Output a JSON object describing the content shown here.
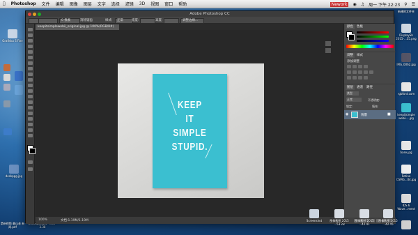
{
  "menubar": {
    "apple": "",
    "app": "Photoshop",
    "items": [
      "文件",
      "编辑",
      "图像",
      "图层",
      "文字",
      "选择",
      "滤镜",
      "3D",
      "视图",
      "窗口",
      "帮助"
    ],
    "right_app": "Nework",
    "clock": "周一 下午 22:23"
  },
  "window": {
    "title": "Adobe Photoshop CC",
    "doc_tab": "keepitsimplewebii_original.jpg @ 100%(RGB/8#)",
    "options": {
      "feather_value": "0 像素",
      "antialias": "消除锯齿",
      "style_label": "样式:",
      "style_value": "正常",
      "width_label": "宽度:",
      "height_label": "高度:",
      "refine": "调整边缘..."
    },
    "status": {
      "zoom": "100%",
      "doc": "文档:1.19M/1.19M"
    }
  },
  "artwork": {
    "lines": [
      "KEEP",
      "IT",
      "SIMPLE",
      "STUPID."
    ],
    "card_color": "#3bbfd0"
  },
  "panels": {
    "color_tabs": [
      "颜色",
      "色板"
    ],
    "adjust_tabs": [
      "调整",
      "样式"
    ],
    "adjust_title": "添加调整",
    "layers_tabs": [
      "图层",
      "通道",
      "路径"
    ],
    "kind_label": "类型",
    "blend_mode": "正常",
    "opacity_label": "不透明度:",
    "lock_label": "锁定:",
    "fill_label": "填充:",
    "layer_name": "背景"
  },
  "desktop_left": [
    {
      "label": "Grafiska S Fixe",
      "color": "#c9d6e6"
    },
    {
      "label": "",
      "color": "#c26b3c"
    },
    {
      "label": "",
      "color": "#d8d8d8"
    },
    {
      "label": "",
      "color": "#aab"
    },
    {
      "label": "",
      "color": "#3a72c8"
    },
    {
      "label": "",
      "color": "#6aa3d8"
    },
    {
      "label": "",
      "color": "#8899aa"
    },
    {
      "label": "",
      "color": "#3d7cc9"
    },
    {
      "label": "deskpgg.jpg",
      "color": "#6a8fbf"
    },
    {
      "label": "是新视频 最山老 新闻.pdf",
      "color": "#e8e8e8"
    },
    {
      "label": "免费数据频道表 V502 - 3.38",
      "color": "#dcdcdc"
    }
  ],
  "desktop_right": [
    {
      "label": "新建的文件夹",
      "color": "#ececec"
    },
    {
      "label": "DisplaySh 2015-...35.png",
      "color": "#cfd8e2"
    },
    {
      "label": "IMG_0062.jpg",
      "color": "#556"
    },
    {
      "label": "rgbfont.com",
      "color": "#e6e6e6"
    },
    {
      "label": "keepitsimple webii....jpg",
      "color": "#3bbfd0"
    },
    {
      "label": "base.jpg",
      "color": "#e8e8e8"
    },
    {
      "label": "Retina CSMG...04.jpg",
      "color": "#eeeeee"
    },
    {
      "label": "IDS 6 Wave...ment",
      "color": "#dadada"
    },
    {
      "label": "",
      "color": "#d0d0d0"
    }
  ],
  "bottom_icons": [
    {
      "label": "Screenshot",
      "color": "#cbd5e0"
    },
    {
      "label": "图像截图 2015 ...53.28",
      "color": "#d8dde4"
    },
    {
      "label": "图像截图 2015 ...42.41",
      "color": "#d8dde4"
    },
    {
      "label": "图像截图 2015 ...42.45",
      "color": "#d8dde4"
    }
  ],
  "colors": {
    "ps_bg": "#2b2b2b",
    "panel_bg": "#474747",
    "layer_selected": "#5b6d82"
  }
}
